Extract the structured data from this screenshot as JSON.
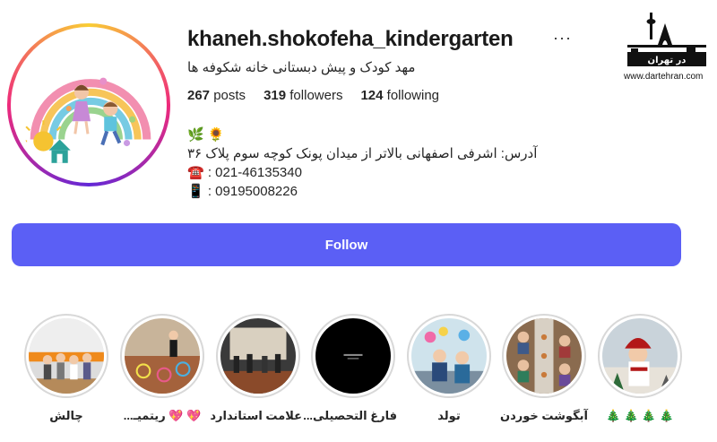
{
  "profile": {
    "username": "khaneh.shokofeha_kindergarten",
    "more": "···",
    "fullname": "مهد کودک و پیش دبستانی خانه شکوفه ها",
    "stats": {
      "posts_count": "267",
      "posts_label": "posts",
      "followers_count": "319",
      "followers_label": "followers",
      "following_count": "124",
      "following_label": "following"
    },
    "bio": {
      "line1": "🌿 🌻",
      "line2": "آدرس: اشرفی اصفهانی بالاتر از میدان پونک کوچه سوم پلاک ۳۶",
      "line3": "☎️ : 021-46135340",
      "line4": "📱 : 09195008226"
    }
  },
  "watermark": {
    "name": "در تهران",
    "url": "www.dartehran.com"
  },
  "follow_button": {
    "label": "Follow"
  },
  "highlights": [
    {
      "label": "🎄 🎄 🎄 🎄",
      "theme": "snowman-kid"
    },
    {
      "label": "آبگوشت خوردن",
      "theme": "lunch-table"
    },
    {
      "label": "تولد",
      "theme": "birthday"
    },
    {
      "label": "فارغ التحصیلی...",
      "theme": "black-card"
    },
    {
      "label": "علامت استاندارد",
      "theme": "stage"
    },
    {
      "label": "💖 💖 ریتمیـ...",
      "theme": "rhythm-floor"
    },
    {
      "label": "چالش",
      "theme": "kids-group"
    }
  ],
  "colors": {
    "follow_button": "#5b5ff5",
    "text": "#262626",
    "ring_gray": "#d8d8d8"
  }
}
